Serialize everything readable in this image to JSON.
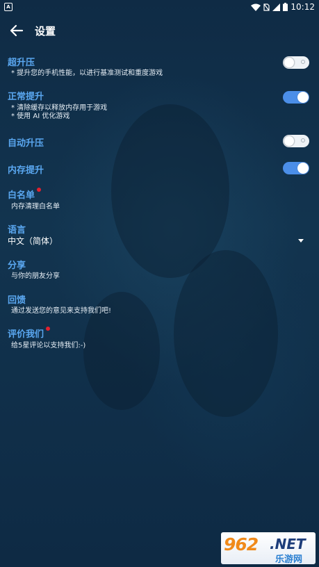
{
  "status_bar": {
    "app_icon_letter": "A",
    "time": "10:12",
    "icons": [
      "wifi-icon",
      "sim-off-icon",
      "signal-icon",
      "battery-icon"
    ]
  },
  "toolbar": {
    "title": "设置",
    "back_icon": "arrow-left-icon"
  },
  "settings": {
    "super_boost": {
      "title": "超升压",
      "desc": "* 提升您的手机性能，以进行基准测试和重度游戏",
      "enabled": false
    },
    "normal_boost": {
      "title": "正常提升",
      "desc_line1": "* 清除缓存以释放内存用于游戏",
      "desc_line2": "* 使用 AI 优化游戏",
      "enabled": true
    },
    "auto_boost": {
      "title": "自动升压",
      "enabled": false
    },
    "memory_boost": {
      "title": "内存提升",
      "enabled": true
    },
    "whitelist": {
      "title": "白名单",
      "desc": "内存清理白名单"
    },
    "language": {
      "title": "语言",
      "selected": "中文（简体）"
    },
    "share": {
      "title": "分享",
      "desc": "与你的朋友分享"
    },
    "feedback": {
      "title": "回馈",
      "desc": "通过发送您的意见来支持我们吧!"
    },
    "rate": {
      "title": "评价我们",
      "desc": "给5星评论以支持我们:-)"
    }
  },
  "watermark": {
    "numbers": "962",
    "net": ".NET",
    "text": "乐游网"
  },
  "colors": {
    "accent": "#5aa7f0",
    "toggle_on": "#4b8ee8",
    "badge": "#e2212f",
    "background": "#102d48"
  }
}
